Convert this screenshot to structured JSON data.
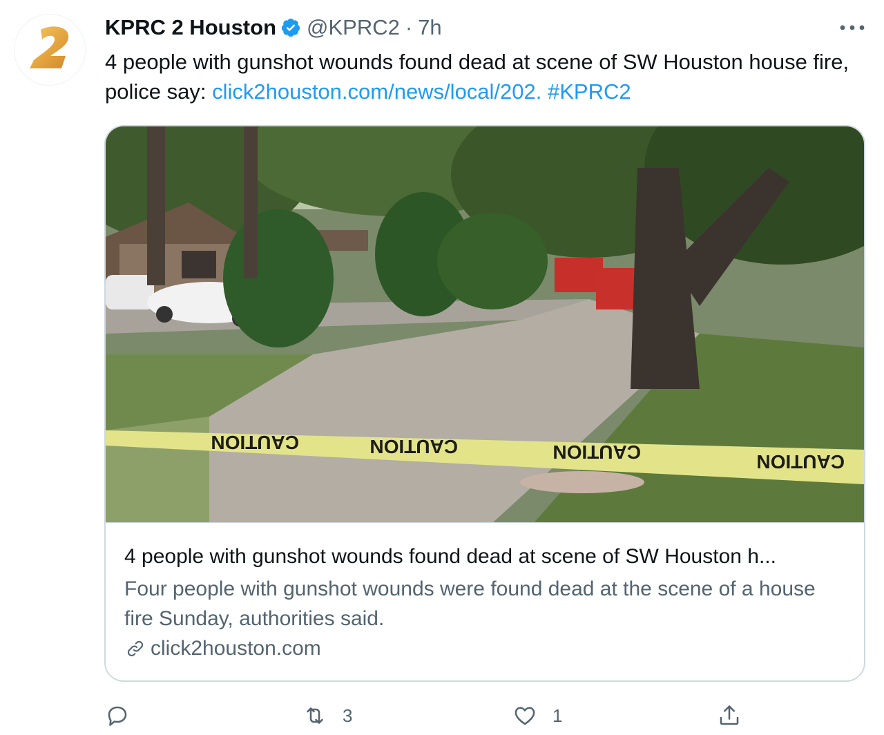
{
  "author": {
    "display_name": "KPRC 2 Houston",
    "handle": "@KPRC2",
    "separator": "·",
    "time": "7h",
    "verified": true,
    "avatar_icon": "kprc2-logo-icon"
  },
  "tweet": {
    "text": "4 people with gunshot wounds found dead at scene of SW Houston house fire, police say: ",
    "link_text": "click2houston.com/news/local/202.",
    "hashtag": "#KPRC2"
  },
  "card": {
    "image_alt": "Caution tape across a residential street with a fire truck in the distance",
    "tape_label": "CAUTION",
    "title": "4 people with gunshot wounds found dead at scene of SW Houston h...",
    "description": "Four people with gunshot wounds were found dead at the scene of a house fire Sunday, authorities said.",
    "domain": "click2houston.com"
  },
  "actions": {
    "reply_count": "",
    "retweet_count": "3",
    "like_count": "1",
    "share_count": ""
  },
  "colors": {
    "accent": "#1d9bf0",
    "text": "#0f1419",
    "muted": "#536471",
    "border": "#cfd9de",
    "logo_gold": "#e7a93a"
  }
}
